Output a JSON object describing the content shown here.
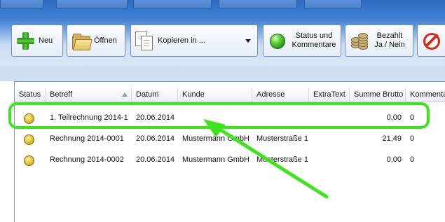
{
  "toolbar": {
    "new_label": "Neu",
    "open_label": "Öffnen",
    "copy_label": "Kopieren in ...",
    "status_label": "Status und Kommentare",
    "paid_label": "Bezahlt Ja / Nein"
  },
  "table": {
    "columns": [
      "Status",
      "Betreff",
      "Datum",
      "Kunde",
      "Adresse",
      "ExtraText",
      "Summe Brutto",
      "Kommentar"
    ],
    "sorted_column": "Betreff",
    "sort_direction": "ascending",
    "rows": [
      {
        "status": "yellow",
        "betreff": "1. Teilrechnung 2014-1",
        "datum": "20.06.2014",
        "kunde": "",
        "adresse": "",
        "extratext": "",
        "summe": "0,00",
        "kommentar": "0",
        "highlighted": true
      },
      {
        "status": "yellow",
        "betreff": "Rechnung 2014-0001",
        "datum": "20.06.2014",
        "kunde": "Mustermann GmbH",
        "adresse": "Musterstraße 1",
        "extratext": "",
        "summe": "21,49",
        "kommentar": "0",
        "highlighted": false
      },
      {
        "status": "yellow",
        "betreff": "Rechnung 2014-0002",
        "datum": "20.06.2014",
        "kunde": "Mustermann GmbH",
        "adresse": "Musterstraße 1",
        "extratext": "",
        "summe": "0,00",
        "kommentar": "0",
        "highlighted": false
      }
    ]
  },
  "annotation": {
    "color": "#3fe51c"
  },
  "colors": {
    "status_yellow": "#e8c83a",
    "header_band": "#3a78cc"
  }
}
